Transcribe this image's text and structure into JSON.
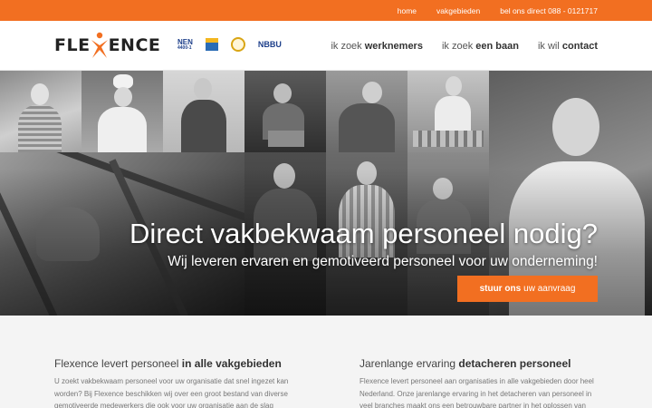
{
  "topbar": {
    "links": [
      "home",
      "vakgebieden",
      "bel ons direct 088 - 0121717"
    ]
  },
  "logo": {
    "text_left": "FLE",
    "text_right": "ENCE",
    "accent_color": "#f26f21"
  },
  "certifications": {
    "nen_line1": "NEN",
    "nen_line2": "4400-1",
    "nbbu": "NBBU"
  },
  "nav": [
    {
      "prefix": "ik zoek",
      "strong": "werknemers"
    },
    {
      "prefix": "ik zoek",
      "strong": "een baan"
    },
    {
      "prefix": "ik wil",
      "strong": "contact"
    }
  ],
  "hero": {
    "title": "Direct vakbekwaam personeel nodig?",
    "subtitle": "Wij leveren ervaren en gemotiveerd personeel voor uw onderneming!",
    "cta_strong": "stuur ons",
    "cta_rest": "uw aanvraag"
  },
  "sections": [
    {
      "title_plain": "Flexence levert personeel",
      "title_strong": "in alle vakgebieden",
      "text": "U zoekt vakbekwaam personeel voor uw organisatie dat snel ingezet kan worden? Bij Flexence beschikken wij over een groot bestand van diverse gemotiveerde medewerkers die ook voor uw organisatie aan de slag"
    },
    {
      "title_plain": "Jarenlange ervaring",
      "title_strong": "detacheren personeel",
      "text": "Flexence levert personeel aan organisaties in alle vakgebieden door heel Nederland. Onze jarenlange ervaring in het detacheren van personeel in veel branches maakt ons een betrouwbare partner in het oplossen van"
    }
  ],
  "colors": {
    "brand_orange": "#f26f21",
    "dark_text": "#333333",
    "muted_text": "#777777"
  }
}
